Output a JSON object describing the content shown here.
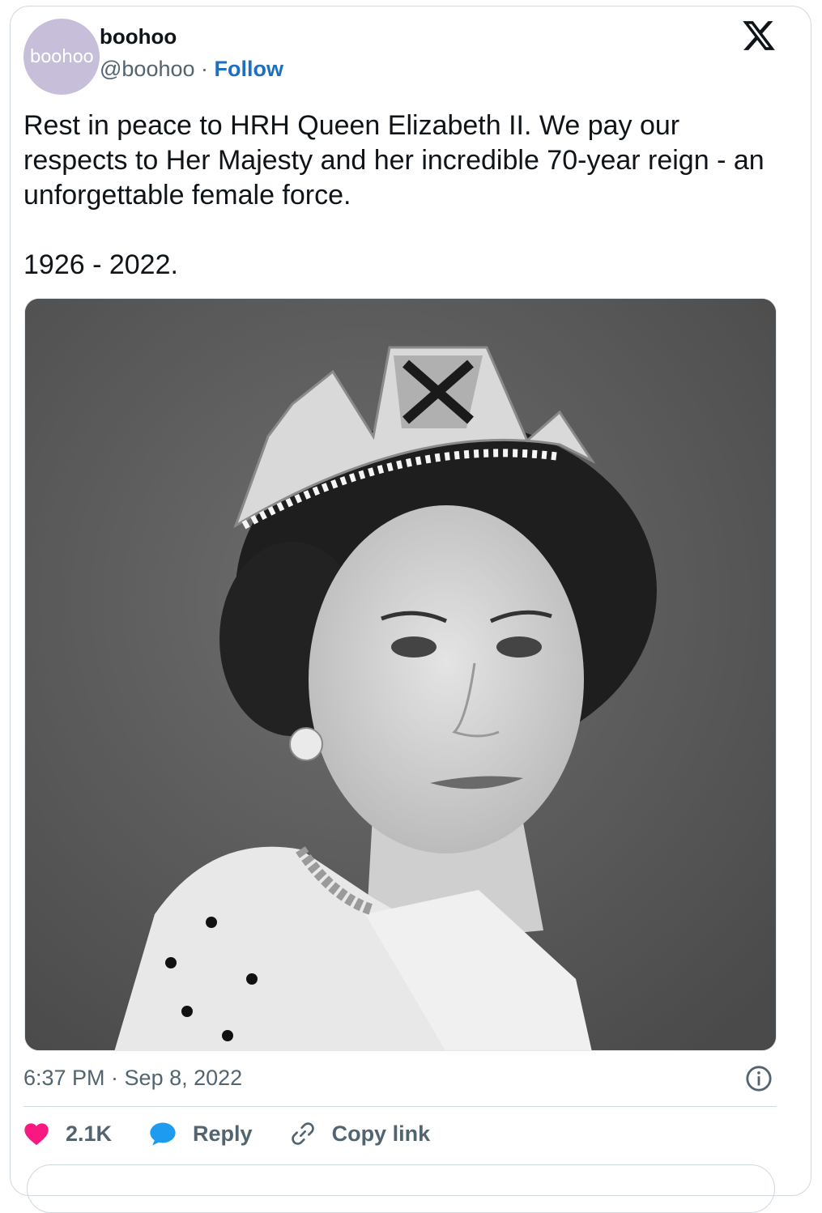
{
  "author": {
    "avatar_text": "boohoo",
    "name": "boohoo",
    "handle": "@boohoo",
    "separator": " · ",
    "follow_label": "Follow"
  },
  "tweet": {
    "text": "Rest in peace to HRH Queen Elizabeth II. We pay our respects to Her Majesty and her incredible 70-year reign - an unforgettable female force.\n\n1926 - 2022.",
    "timestamp": "6:37 PM · Sep 8, 2022"
  },
  "actions": {
    "likes": "2.1K",
    "reply_label": "Reply",
    "copy_link_label": "Copy link"
  },
  "icons": {
    "brand": "x-logo-icon",
    "info": "info-icon",
    "like": "heart-icon",
    "reply": "speech-bubble-icon",
    "copy": "link-icon"
  },
  "colors": {
    "follow": "#1d6fc2",
    "heart": "#f91880",
    "reply_bubble": "#1d9bf0",
    "avatar_bg": "#c7bfd9",
    "muted_text": "#536471"
  }
}
